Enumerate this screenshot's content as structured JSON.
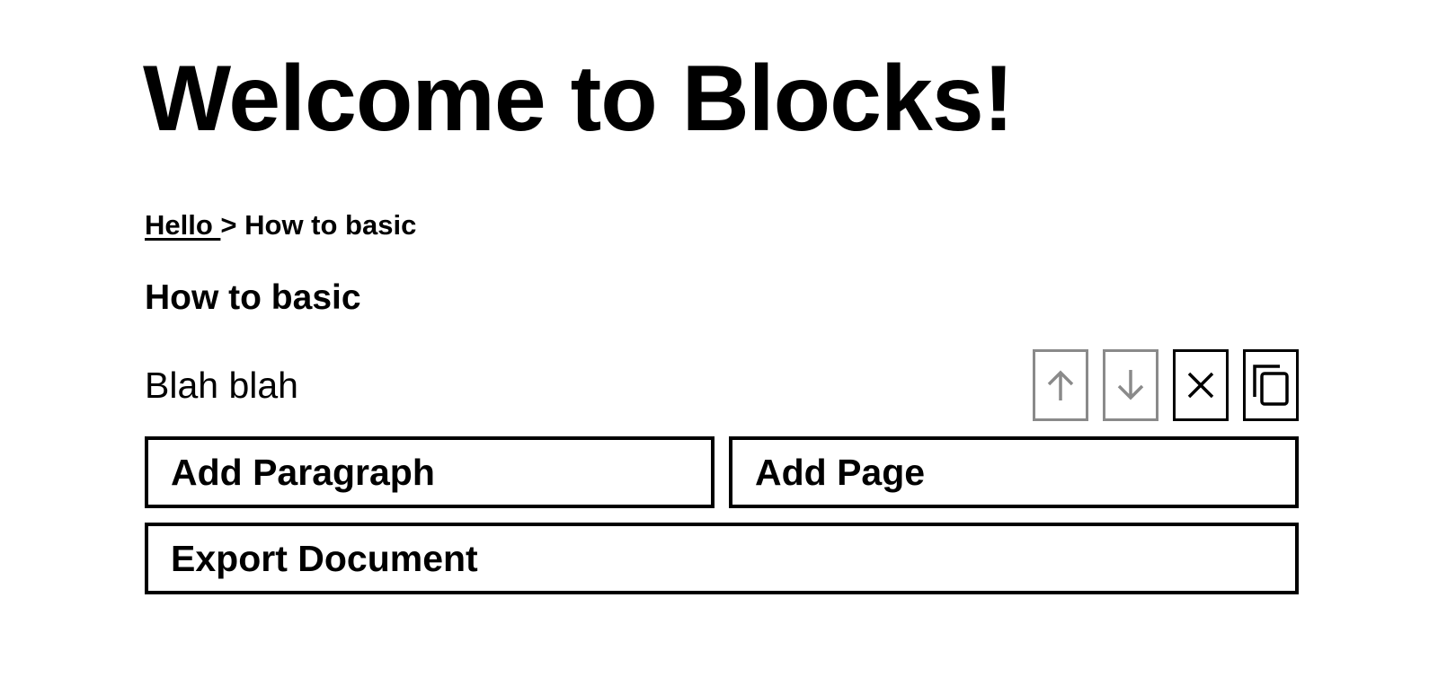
{
  "app": {
    "title": "Welcome to Blocks!"
  },
  "breadcrumb": {
    "parent_label": "Hello ",
    "separator": " > ",
    "current_label": "How to basic"
  },
  "page": {
    "heading": "How to basic"
  },
  "blocks": [
    {
      "type": "paragraph",
      "text": "Blah blah",
      "controls": {
        "move_up": {
          "icon": "arrow-up-icon",
          "enabled": false,
          "color": "#8a8a8a"
        },
        "move_down": {
          "icon": "arrow-down-icon",
          "enabled": false,
          "color": "#8a8a8a"
        },
        "delete": {
          "icon": "close-icon",
          "enabled": true,
          "color": "#000000"
        },
        "duplicate": {
          "icon": "copy-icon",
          "enabled": true,
          "color": "#000000"
        }
      }
    }
  ],
  "actions": {
    "add_paragraph_label": "Add Paragraph",
    "add_page_label": "Add Page",
    "export_label": "Export Document"
  },
  "colors": {
    "foreground": "#000000",
    "background": "#ffffff",
    "disabled": "#8a8a8a"
  }
}
